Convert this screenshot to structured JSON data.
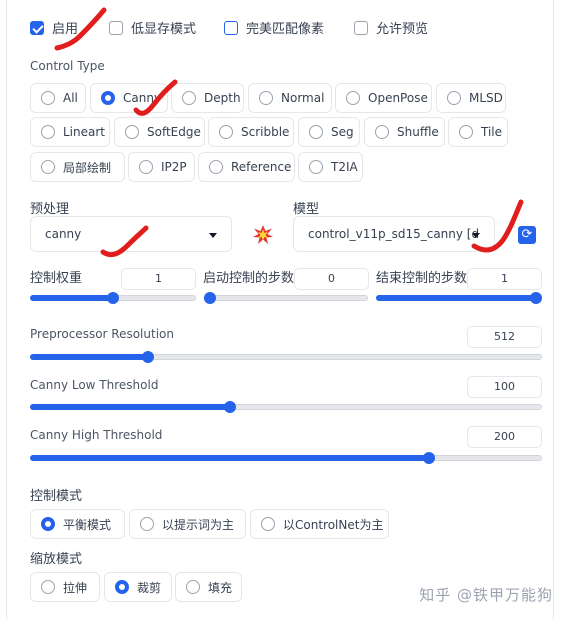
{
  "options": {
    "enable": {
      "label": "启用",
      "checked": true
    },
    "low_vram": {
      "label": "低显存模式",
      "checked": false
    },
    "pixel_perfect": {
      "label": "完美匹配像素",
      "checked": false
    },
    "allow_preview": {
      "label": "允许预览",
      "checked": false
    }
  },
  "control_type": {
    "label": "Control Type",
    "selected": "Canny",
    "items": [
      "All",
      "Canny",
      "Depth",
      "Normal",
      "OpenPose",
      "MLSD",
      "Lineart",
      "SoftEdge",
      "Scribble",
      "Seg",
      "Shuffle",
      "Tile",
      "局部绘制",
      "IP2P",
      "Reference",
      "T2IA"
    ]
  },
  "preprocessor": {
    "label": "预处理",
    "value": "canny"
  },
  "model": {
    "label": "模型",
    "value": "control_v11p_sd15_canny [d"
  },
  "icons": {
    "run_preprocessor": "explosion-icon",
    "refresh": "refresh-icon"
  },
  "control_weight": {
    "label": "控制权重",
    "value": "1",
    "fraction": 0.5
  },
  "starting_step": {
    "label": "启动控制的步数",
    "value": "0",
    "fraction": 0.0
  },
  "ending_step": {
    "label": "结束控制的步数",
    "value": "1",
    "fraction": 1.0
  },
  "preprocessor_resolution": {
    "label": "Preprocessor Resolution",
    "value": "512",
    "fraction": 0.23
  },
  "canny_low": {
    "label": "Canny Low Threshold",
    "value": "100",
    "fraction": 0.39
  },
  "canny_high": {
    "label": "Canny High Threshold",
    "value": "200",
    "fraction": 0.78
  },
  "control_mode": {
    "label": "控制模式",
    "selected": "平衡模式",
    "items": [
      "平衡模式",
      "以提示词为主",
      "以ControlNet为主"
    ]
  },
  "resize_mode": {
    "label": "缩放模式",
    "selected": "裁剪",
    "items": [
      "拉伸",
      "裁剪",
      "填充"
    ]
  },
  "watermark": "知乎 @铁甲万能狗",
  "colors": {
    "accent": "#2563eb",
    "annotation": "#e11d1d"
  }
}
